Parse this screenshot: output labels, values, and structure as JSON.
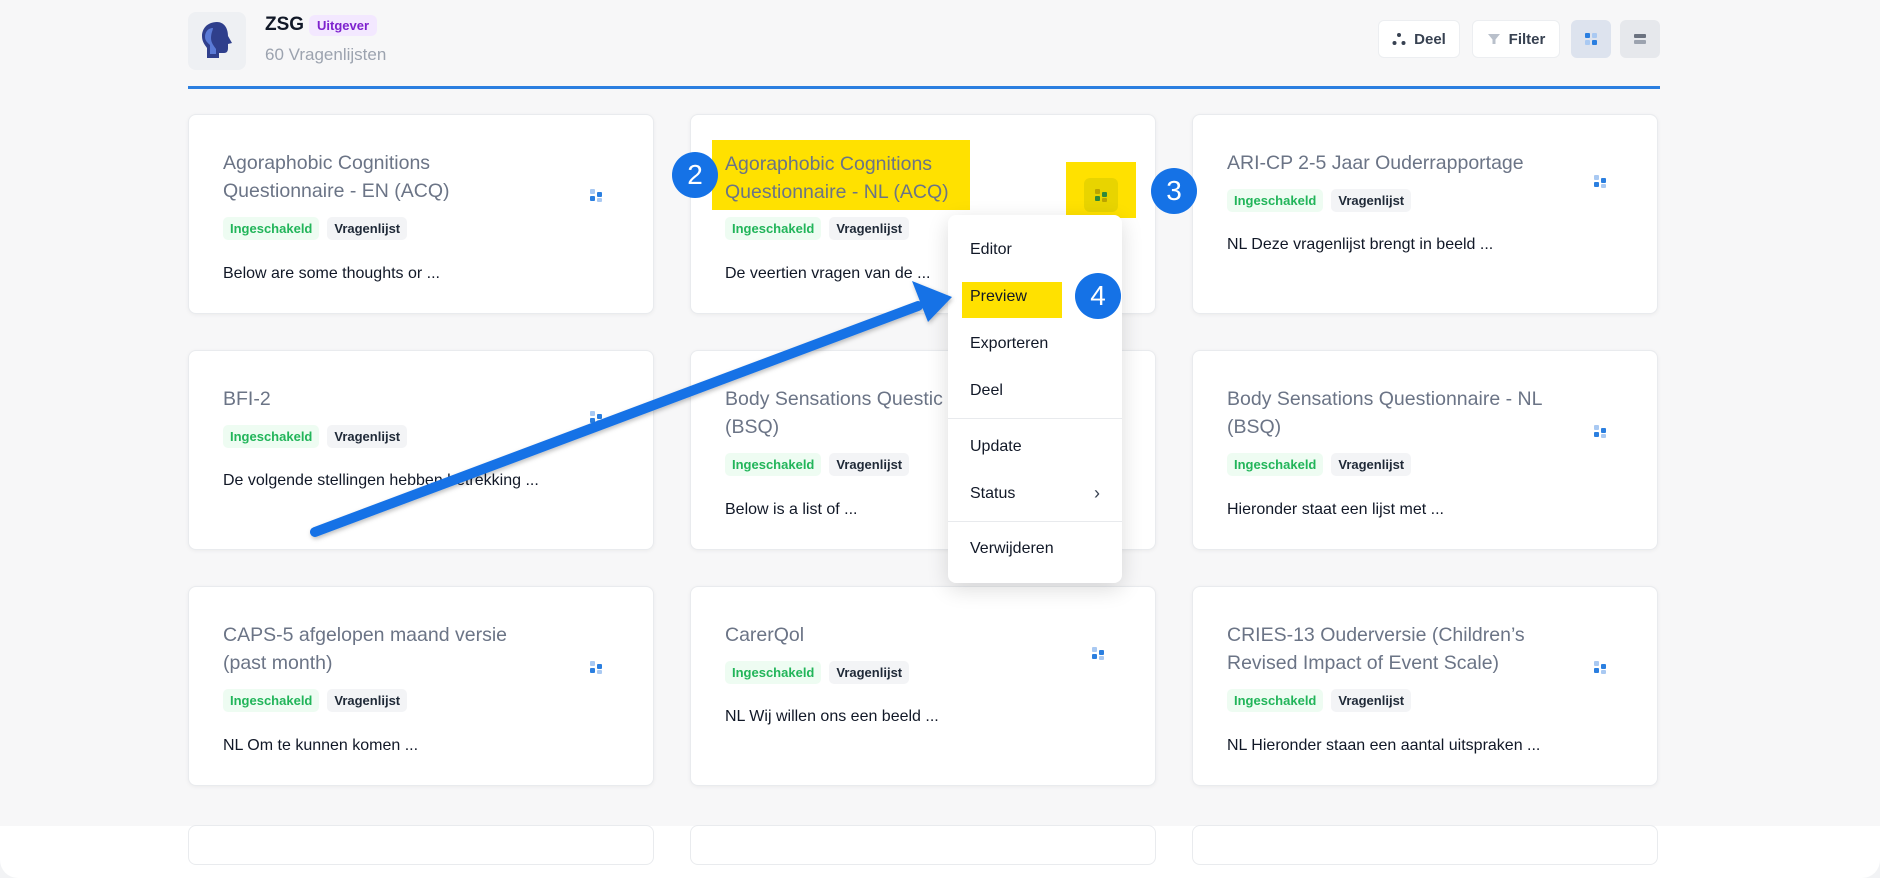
{
  "header": {
    "org_name": "ZSG",
    "org_badge": "Uitgever",
    "count": "60 Vragenlijsten",
    "share_label": "Deel",
    "filter_label": "Filter"
  },
  "tag_enabled": "Ingeschakeld",
  "tag_type": "Vragenlijst",
  "cards": [
    {
      "title": "Agoraphobic Cognitions Questionnaire - EN (ACQ)",
      "desc": "Below are some thoughts or ..."
    },
    {
      "title": "Agoraphobic Cognitions Questionnaire - NL (ACQ)",
      "desc": "De veertien vragen van de ..."
    },
    {
      "title": "ARI-CP 2-5 Jaar Ouderrapportage",
      "desc": "NL Deze vragenlijst brengt in beeld ..."
    },
    {
      "title": "BFI-2",
      "desc": "De volgende stellingen hebben betrekking ..."
    },
    {
      "title": "Body Sensations Questionnaire - NL (BSQ)",
      "title_visible": "Body Sensations Questic",
      "title_line2": "(BSQ)",
      "desc": "Below is a list of ..."
    },
    {
      "title": "Body Sensations Questionnaire - NL (BSQ)",
      "desc": "Hieronder staat een lijst met ..."
    },
    {
      "title": "CAPS-5 afgelopen maand versie (past month)",
      "desc": "NL  Om te kunnen komen ..."
    },
    {
      "title": "CarerQol",
      "desc": "NL Wij willen ons een beeld ..."
    },
    {
      "title": "CRIES-13 Ouderversie (Children’s Revised Impact of Event Scale)",
      "desc": "NL Hieronder staan een aantal uitspraken ..."
    }
  ],
  "menu": {
    "editor": "Editor",
    "preview": "Preview",
    "export": "Exporteren",
    "share": "Deel",
    "update": "Update",
    "status": "Status",
    "delete": "Verwijderen"
  },
  "steps": {
    "s2": "2",
    "s3": "3",
    "s4": "4"
  },
  "colors": {
    "accent": "#2b7fe0",
    "highlight": "#ffe100",
    "step_marker": "#1572e6",
    "tag_green": "#22b55a"
  }
}
